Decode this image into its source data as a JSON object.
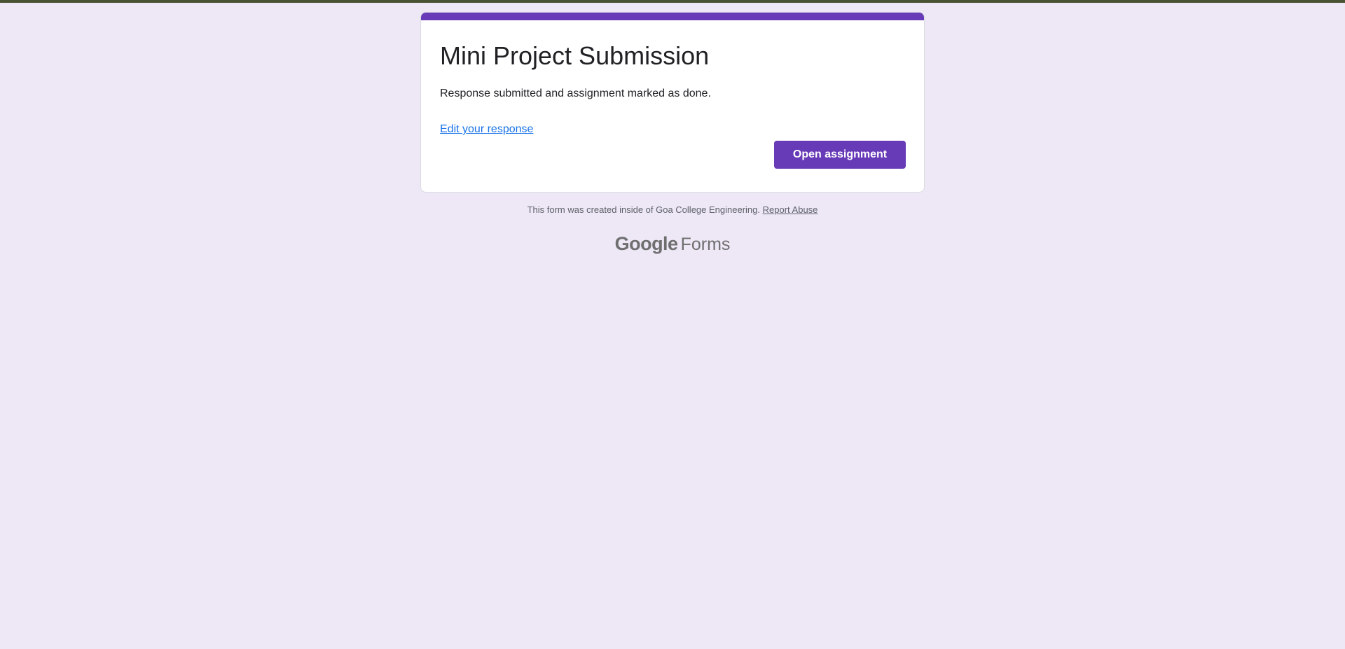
{
  "colors": {
    "page_background": "#ede7f6",
    "accent": "#673ab7",
    "link": "#1a73e8",
    "footer_text": "#5f6368"
  },
  "form": {
    "title": "Mini Project Submission",
    "confirmation_message": "Response submitted and assignment marked as done.",
    "edit_link_label": "Edit your response",
    "open_assignment_label": "Open assignment"
  },
  "footer": {
    "created_note": "This form was created inside of Goa College Engineering.",
    "report_abuse_label": "Report Abuse",
    "brand_google": "Google",
    "brand_forms": "Forms"
  }
}
